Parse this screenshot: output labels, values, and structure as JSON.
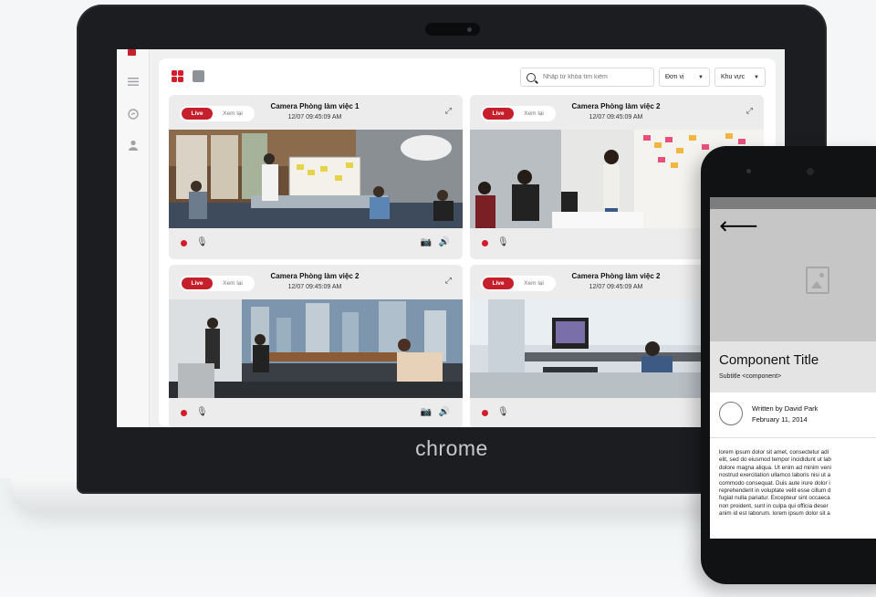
{
  "laptop": {
    "brand": "chrome"
  },
  "toolbar": {
    "search_placeholder": "Nhập từ khóa tìm kiếm",
    "unit_select": "Đơn vị",
    "area_select": "Khu vực"
  },
  "cameras": [
    {
      "live_label": "Live",
      "replay_label": "Xem lại",
      "title": "Camera Phòng làm việc 1",
      "time": "12/07 09:45:09 AM"
    },
    {
      "live_label": "Live",
      "replay_label": "Xem lại",
      "title": "Camera Phòng làm việc 2",
      "time": "12/07 09:45:09 AM"
    },
    {
      "live_label": "Live",
      "replay_label": "Xem lại",
      "title": "Camera Phòng làm việc 2",
      "time": "12/07 09:45:09 AM"
    },
    {
      "live_label": "Live",
      "replay_label": "Xem lại",
      "title": "Camera Phòng làm việc 2",
      "time": "12/07 09:45:09 AM"
    }
  ],
  "colors": {
    "accent": "#c41f2a"
  },
  "phone": {
    "title": "Component Title",
    "subtitle": "Subtitle <component>",
    "author": "Written by David Park",
    "date": "February 11, 2014",
    "body_lines": [
      "lorem ipsum dolor sit amet, consectetur adi",
      "elit, sed do eiusmod tempor incididunt ut lab",
      "dolore magna aliqua. Ut enim ad minim veni",
      "nostrud exercitation ullamco laboris nisi ut a",
      "commodo consequat. Duis aute irure dolor i",
      "reprehenderit in voluptate velit esse cillum d",
      "fugiat nulla pariatur. Excepteur sint occaeca",
      "non proident, sunt in culpa qui officia deser",
      "anim id est laborum. lorem ipsum dolor sit a"
    ]
  }
}
